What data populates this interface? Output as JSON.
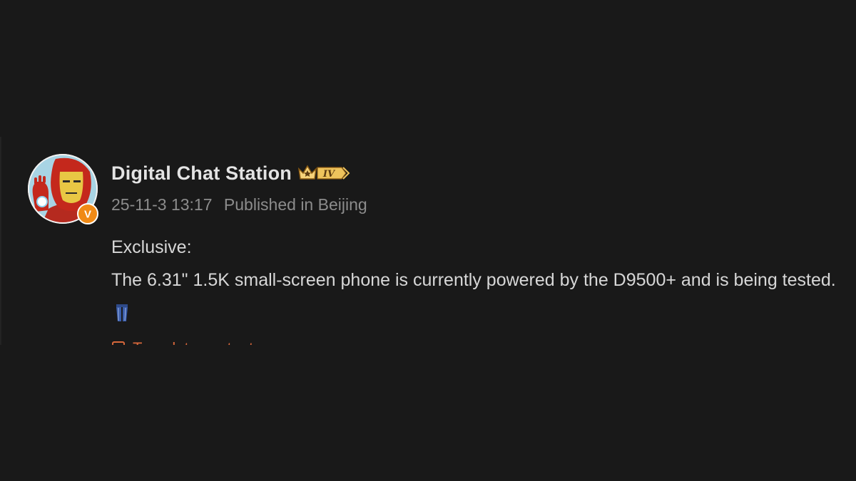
{
  "post": {
    "author": {
      "name": "Digital Chat Station",
      "level_badge": "IV",
      "verified_mark": "V",
      "avatar_icon": "iron-man-avatar-icon"
    },
    "meta": {
      "timestamp": "25-11-3 13:17",
      "location": "Published in Beijing"
    },
    "content": {
      "line1": "Exclusive:",
      "line2": "The 6.31\" 1.5K small-screen phone is currently powered by the D9500+ and is being tested.",
      "emoji_icon": "jeans-icon"
    },
    "translate": {
      "label": "Translate content",
      "icon": "translate-icon"
    }
  },
  "colors": {
    "background": "#191919",
    "author_text": "#e3e3e3",
    "meta_text": "#8c8c8c",
    "body_text": "#d7d7d7",
    "accent": "#d9683b",
    "badge_gold": "#e9b44c"
  }
}
